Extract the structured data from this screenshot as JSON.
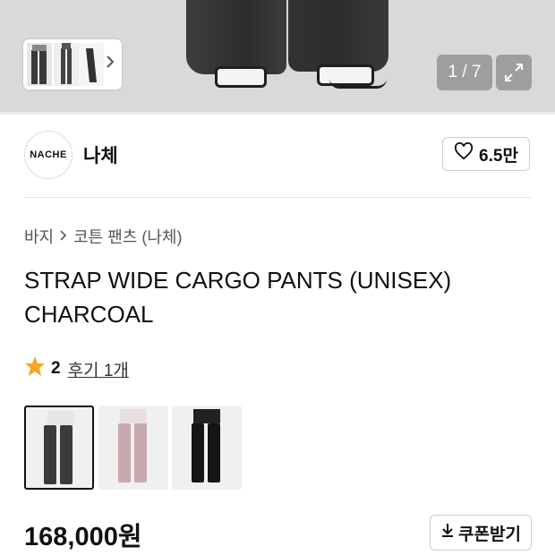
{
  "gallery": {
    "page_indicator": "1 / 7",
    "thumbnails_more_icon": "chevron-right-icon",
    "expand_icon": "expand-icon"
  },
  "brand": {
    "logo_text": "NACHE",
    "name": "나체",
    "likes": "6.5만"
  },
  "breadcrumb": {
    "category": "바지",
    "subcategory": "코튼 팬츠 (나체)"
  },
  "product": {
    "title": "STRAP WIDE CARGO PANTS (UNISEX) CHARCOAL",
    "rating": "2",
    "review_link": "후기 1개",
    "price": "168,000원",
    "coupon_label": "쿠폰받기"
  },
  "color_options": [
    {
      "name": "charcoal",
      "selected": true
    },
    {
      "name": "pink",
      "selected": false
    },
    {
      "name": "black",
      "selected": false
    }
  ],
  "colors": {
    "star": "#F5A623",
    "text": "#111111"
  }
}
